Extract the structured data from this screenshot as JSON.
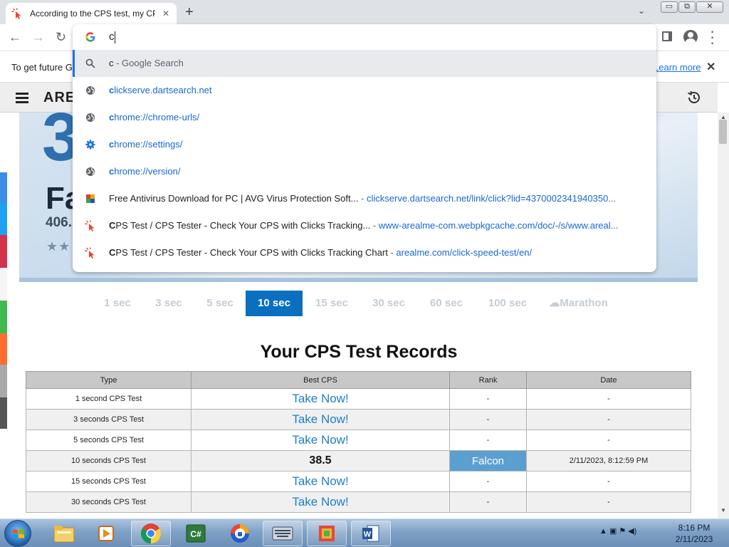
{
  "tab": {
    "title": "According to the CPS test, my CP",
    "close": "✕"
  },
  "new_tab": "+",
  "tab_search": "⌄",
  "window_controls": {
    "minimize": "▭",
    "restore": "⧉",
    "close": "✕"
  },
  "nav": {
    "back": "←",
    "forward": "→",
    "reload": "↻"
  },
  "omnibox": {
    "value": "c",
    "suggestions": [
      {
        "icon": "search-icon",
        "bold": "c",
        "rest": " - Google Search",
        "sep": "",
        "url": ""
      },
      {
        "icon": "globe-icon",
        "bold": "c",
        "rest": "lickserve.dartsearch.net",
        "sep": "",
        "url": ""
      },
      {
        "icon": "globe-icon",
        "bold": "c",
        "rest": "hrome://chrome-urls/",
        "sep": "",
        "url": ""
      },
      {
        "icon": "gear-icon",
        "bold": "c",
        "rest": "hrome://settings/",
        "sep": "",
        "url": ""
      },
      {
        "icon": "globe-icon",
        "bold": "c",
        "rest": "hrome://version/",
        "sep": "",
        "url": ""
      },
      {
        "icon": "avg-icon",
        "bold": "",
        "rest": "Free Antivirus Download for PC | AVG Virus Protection Soft...",
        "sep": " - ",
        "url": "clickserve.dartsearch.net/link/click?lid=4370002341940350..."
      },
      {
        "icon": "cps-icon",
        "bold": "C",
        "rest": "PS Test / CPS Tester - Check Your CPS with Clicks Tracking...",
        "sep": " - ",
        "url": "www-arealme-com.webpkgcache.com/doc/-/s/www.areal..."
      },
      {
        "icon": "cps-icon",
        "bold": "C",
        "rest": "PS Test / CPS Tester - Check Your CPS with Clicks Tracking Chart",
        "sep": " - ",
        "url": "arealme.com/click-speed-test/en/"
      }
    ]
  },
  "infobar": {
    "text": "To get future G",
    "link": "Learn more",
    "close": "✕"
  },
  "site": {
    "logo": "ARE"
  },
  "hero": {
    "big_number": "3",
    "rank": "Fa",
    "cps": "406.",
    "stars": "★★"
  },
  "durations": [
    {
      "label": "1 sec",
      "active": false
    },
    {
      "label": "3 sec",
      "active": false
    },
    {
      "label": "5 sec",
      "active": false
    },
    {
      "label": "10 sec",
      "active": true
    },
    {
      "label": "15 sec",
      "active": false
    },
    {
      "label": "30 sec",
      "active": false
    },
    {
      "label": "60 sec",
      "active": false
    },
    {
      "label": "100 sec",
      "active": false
    },
    {
      "label": "Marathon",
      "active": false
    }
  ],
  "records": {
    "title": "Your CPS Test Records",
    "columns": [
      "Type",
      "Best CPS",
      "Rank",
      "Date"
    ],
    "rows": [
      {
        "type": "1 second CPS Test",
        "best": "Take Now!",
        "rank": "-",
        "date": "-"
      },
      {
        "type": "3 seconds CPS Test",
        "best": "Take Now!",
        "rank": "-",
        "date": "-"
      },
      {
        "type": "5 seconds CPS Test",
        "best": "Take Now!",
        "rank": "-",
        "date": "-"
      },
      {
        "type": "10 seconds CPS Test",
        "best": "38.5",
        "rank": "Falcon",
        "date": "2/11/2023, 8:12:59 PM"
      },
      {
        "type": "15 seconds CPS Test",
        "best": "Take Now!",
        "rank": "-",
        "date": "-"
      },
      {
        "type": "30 seconds CPS Test",
        "best": "Take Now!",
        "rank": "-",
        "date": "-"
      }
    ]
  },
  "taskbar": {
    "apps": [
      "file-explorer-icon",
      "media-player-icon",
      "chrome-icon",
      "csharp-icon",
      "avast-secure-browser-icon",
      "keyboard-icon",
      "winrar-icon",
      "word-icon"
    ],
    "clock_time": "8:16 PM",
    "clock_date": "2/11/2023"
  },
  "colors": {
    "accent": "#0a6fbf",
    "rank_badge": "#5b9fd1",
    "link": "#1a73e8"
  }
}
